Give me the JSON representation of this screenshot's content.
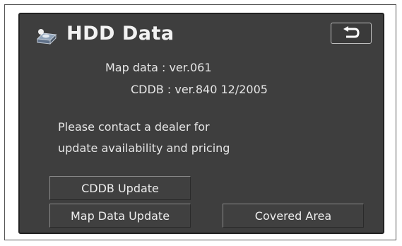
{
  "header": {
    "title": "HDD Data",
    "icon": "hdd-icon",
    "back_icon": "return-arrow-icon"
  },
  "info": {
    "map_data": "Map data : ver.061",
    "cddb": "CDDB : ver.840 12/2005"
  },
  "message": {
    "line1": "Please contact a dealer for",
    "line2": "update availability and pricing"
  },
  "buttons": {
    "cddb_update": "CDDB Update",
    "map_data_update": "Map Data Update",
    "covered_area": "Covered Area"
  },
  "colors": {
    "screen_background": "#3e3e3e",
    "text": "#e6e6e6"
  }
}
